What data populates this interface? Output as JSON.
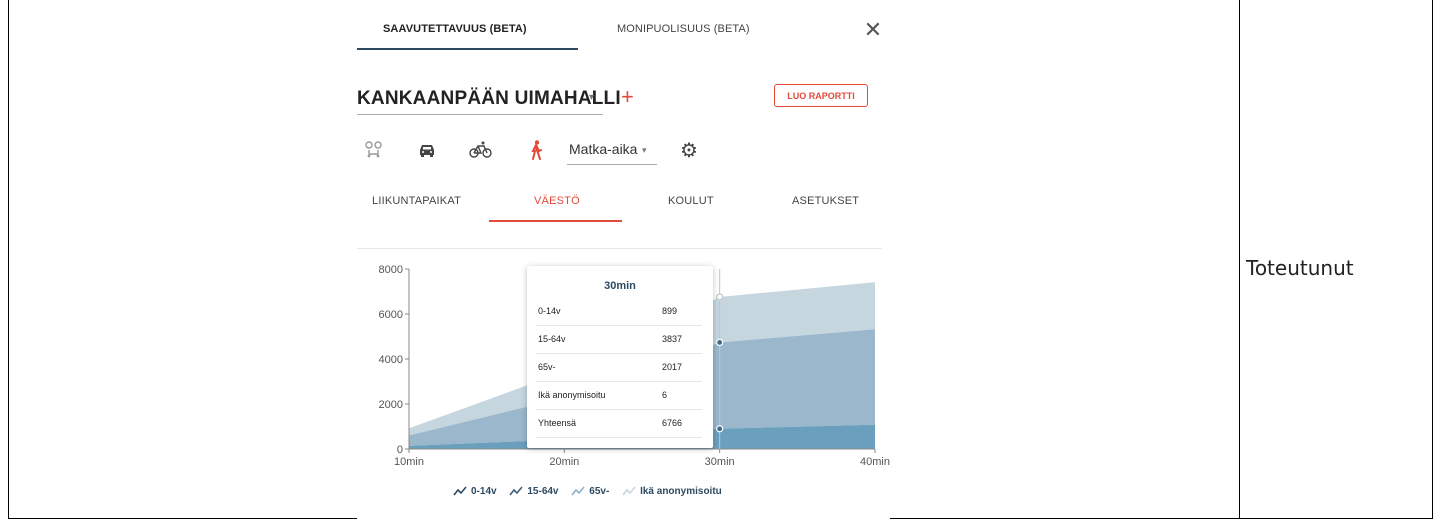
{
  "top_tabs": [
    {
      "label": "SAAVUTETTAVUUS (BETA)",
      "active": true
    },
    {
      "label": "MONIPUOLISUUS (BETA)",
      "active": false
    }
  ],
  "close_glyph": "✕",
  "place": {
    "name": "KANKAANPÄÄN UIMAHALLI",
    "caret": "▾"
  },
  "add_glyph": "+",
  "report_button": "LUO RAPORTTI",
  "travel": {
    "modes": [
      "transit-icon",
      "car-icon",
      "bicycle-icon",
      "walk-icon"
    ],
    "active_mode": "walk-icon",
    "metric": "Matka-aika",
    "caret": "▾",
    "settings_glyph": "⚙"
  },
  "sub_tabs": [
    {
      "label": "LIIKUNTAPAIKAT",
      "active": false
    },
    {
      "label": "VÄESTÖ",
      "active": true
    },
    {
      "label": "KOULUT",
      "active": false
    },
    {
      "label": "ASETUKSET",
      "active": false
    }
  ],
  "chart_data": {
    "type": "area",
    "stacked": true,
    "x": [
      "10min",
      "20min",
      "30min",
      "40min"
    ],
    "y_ticks": [
      "0",
      "2000",
      "4000",
      "6000",
      "8000"
    ],
    "ylim": [
      0,
      8000
    ],
    "series": [
      {
        "name": "0-14v",
        "values": [
          140,
          420,
          899,
          1080
        ]
      },
      {
        "name": "15-64v",
        "values": [
          460,
          1860,
          3837,
          4240
        ]
      },
      {
        "name": "65v-",
        "values": [
          320,
          1150,
          2017,
          2090
        ]
      },
      {
        "name": "Ikä anonymisoitu",
        "values": [
          0,
          2,
          6,
          8
        ]
      }
    ],
    "colors": [
      "#6a9fbe",
      "#9ab7cc",
      "#c6d6df",
      "#e1e8ec"
    ],
    "highlight": "30min",
    "tooltip": {
      "title": "30min",
      "rows": [
        {
          "label": "0-14v",
          "value": "899"
        },
        {
          "label": "15-64v",
          "value": "3837"
        },
        {
          "label": "65v-",
          "value": "2017"
        },
        {
          "label": "Ikä anonymisoitu",
          "value": "6"
        },
        {
          "label": "Yhteensä",
          "value": "6766"
        }
      ]
    },
    "legend": [
      "0-14v",
      "15-64v",
      "65v-",
      "Ikä anonymisoitu"
    ]
  },
  "status_cell": "Toteutunut"
}
